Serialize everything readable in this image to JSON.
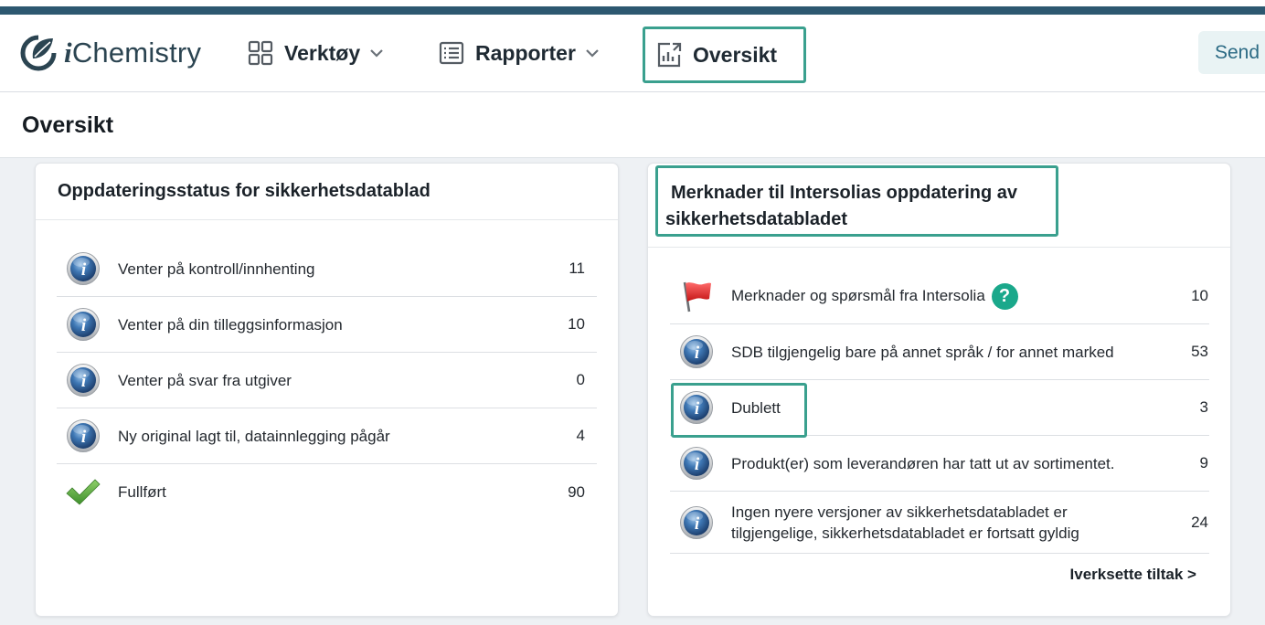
{
  "app": {
    "name": "iChemistry",
    "name_italic": "i",
    "name_rest": "Chemistry"
  },
  "nav": {
    "tools": "Verktøy",
    "reports": "Rapporter",
    "overview": "Oversikt",
    "send": "Send"
  },
  "page": {
    "title": "Oversikt"
  },
  "status_card": {
    "title": "Oppdateringsstatus for sikkerhetsdatablad",
    "rows": [
      {
        "label": "Venter på kontroll/innhenting",
        "count": "11",
        "icon": "info-icon"
      },
      {
        "label": "Venter på din tilleggsinformasjon",
        "count": "10",
        "icon": "info-icon"
      },
      {
        "label": "Venter på svar fra utgiver",
        "count": "0",
        "icon": "info-icon"
      },
      {
        "label": "Ny original lagt til, datainnlegging pågår",
        "count": "4",
        "icon": "info-icon"
      },
      {
        "label": "Fullført",
        "count": "90",
        "icon": "checkmark-icon"
      }
    ]
  },
  "remarks_card": {
    "title_line1": "Merknader til Intersolias oppdatering av",
    "title_line2": "sikkerhetsdatabladet",
    "rows": [
      {
        "label": "Merknader og spørsmål fra Intersolia",
        "count": "10",
        "icon": "red-flag-icon",
        "help": "?"
      },
      {
        "label": "SDB tilgjengelig bare på annet språk / for annet marked",
        "count": "53",
        "icon": "info-icon"
      },
      {
        "label": "Dublett",
        "count": "3",
        "icon": "info-icon"
      },
      {
        "label": "Produkt(er) som leverandøren har tatt ut av sortimentet.",
        "count": "9",
        "icon": "info-icon"
      },
      {
        "label_line1": "Ingen nyere versjoner av sikkerhetsdatabladet er",
        "label_line2": "tilgjengelige, sikkerhetsdatabladet er fortsatt gyldig",
        "count": "24",
        "icon": "info-icon"
      }
    ],
    "action": "Iverksette tiltak >"
  },
  "colors": {
    "accent": "#3aa08e",
    "topbar": "#2d5870",
    "help": "#1aa88b"
  }
}
